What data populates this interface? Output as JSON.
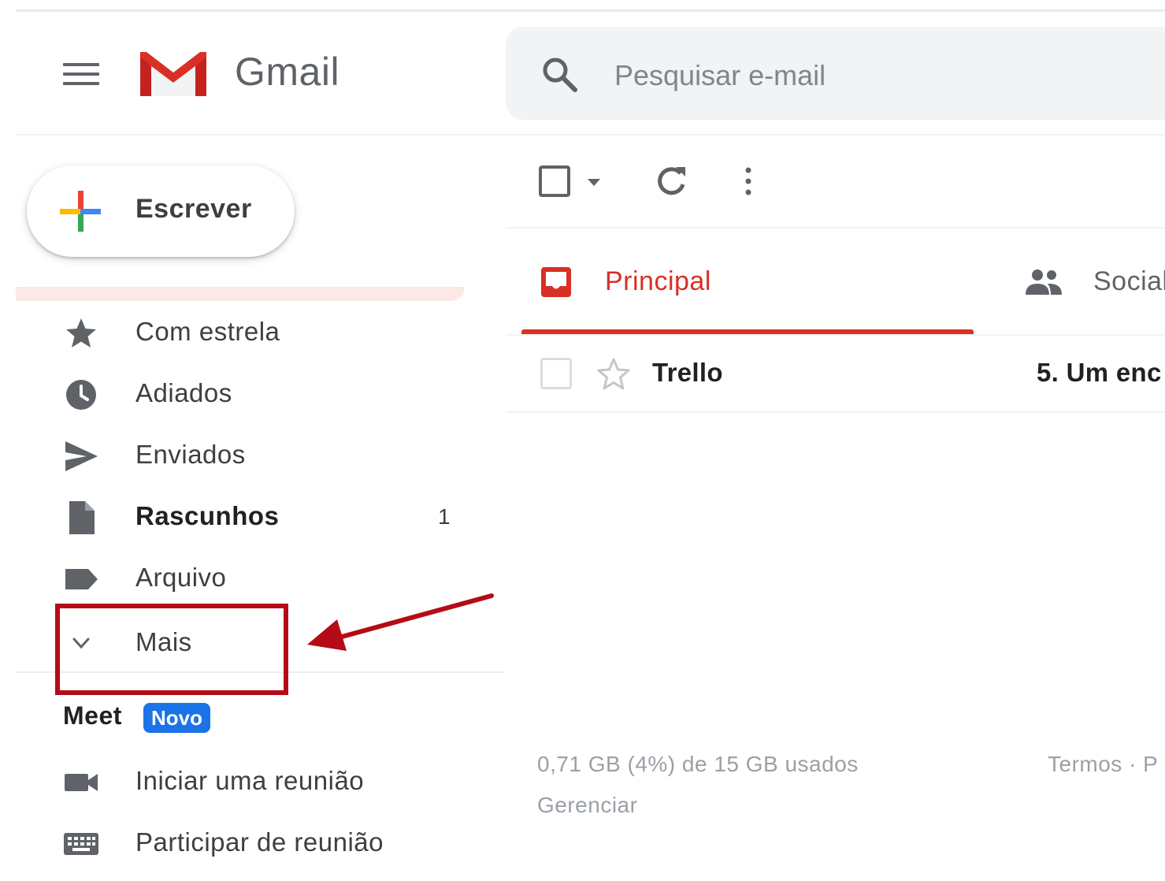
{
  "app": {
    "name": "Gmail"
  },
  "search": {
    "placeholder": "Pesquisar e-mail"
  },
  "compose": {
    "label": "Escrever"
  },
  "sidebar": {
    "items": [
      {
        "label": "Com estrela",
        "icon": "star-icon"
      },
      {
        "label": "Adiados",
        "icon": "clock-icon"
      },
      {
        "label": "Enviados",
        "icon": "send-icon"
      },
      {
        "label": "Rascunhos",
        "icon": "draft-icon",
        "count": "1"
      },
      {
        "label": "Arquivo",
        "icon": "label-icon"
      },
      {
        "label": "Mais",
        "icon": "chevron-down-icon"
      }
    ]
  },
  "meet": {
    "title": "Meet",
    "badge": "Novo",
    "items": [
      {
        "label": "Iniciar uma reunião",
        "icon": "video-icon"
      },
      {
        "label": "Participar de reunião",
        "icon": "keyboard-icon"
      }
    ]
  },
  "tabs": [
    {
      "label": "Principal",
      "icon": "inbox-icon",
      "active": true
    },
    {
      "label": "Social",
      "icon": "people-icon",
      "active": false
    }
  ],
  "emails": [
    {
      "sender": "Trello",
      "subject": "5. Um enc"
    }
  ],
  "footer": {
    "storage": "0,71 GB (4%) de 15 GB usados",
    "manage": "Gerenciar",
    "terms": "Termos · P"
  },
  "colors": {
    "accent_red": "#d93025",
    "highlight_box": "#b50b16",
    "badge_blue": "#1a73e8",
    "search_bg": "#f1f3f4"
  }
}
